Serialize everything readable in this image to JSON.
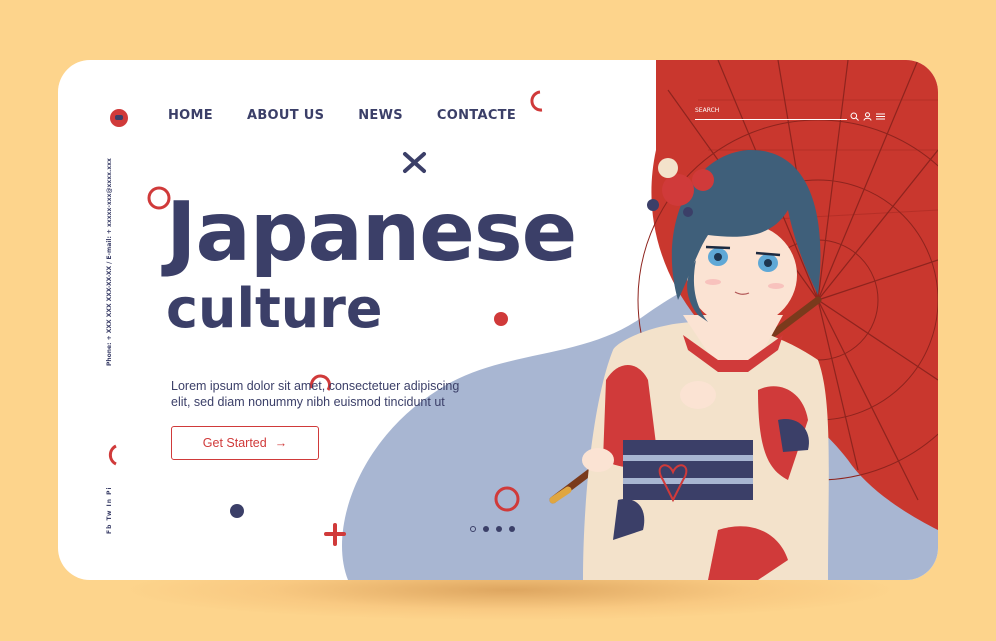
{
  "nav": {
    "items": [
      {
        "label": "HOME"
      },
      {
        "label": "ABOUT US"
      },
      {
        "label": "NEWS"
      },
      {
        "label": "CONTACTE"
      }
    ]
  },
  "header": {
    "search_label": "SEARCH",
    "icons": [
      "search-icon",
      "user-icon",
      "menu-icon"
    ]
  },
  "sidebar": {
    "contact_text": "Phone: + XXX XXX XXX-XX-XX   /   E-mail: + xxxxx-xxx@xxxx.xxx",
    "social_text": "Fb Tw In Pi"
  },
  "hero": {
    "title_line1": "Japanese",
    "title_line2": "culture",
    "description": "Lorem ipsum dolor sit amet, consectetuer adipiscing elit, sed diam nonummy nibh euismod tincidunt ut",
    "cta_label": "Get Started",
    "cta_arrow": "→"
  },
  "carousel": {
    "active_index": 1,
    "count": 4
  },
  "colors": {
    "background": "#fdd48c",
    "navy": "#3b3f68",
    "red": "#d03a3a",
    "blob": "#a8b6d2",
    "umbrella": "#c9372e"
  }
}
